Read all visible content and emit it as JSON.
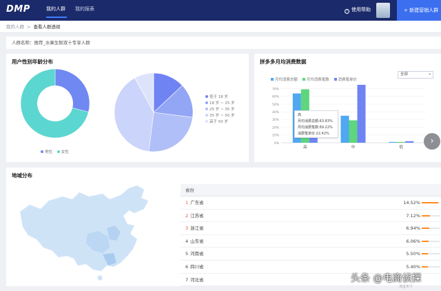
{
  "nav": {
    "logo": "DMP",
    "tabs": [
      {
        "label": "我的人群"
      },
      {
        "label": "我的报表"
      }
    ],
    "help": "使用帮助",
    "new_button": "+ 新建营销人群"
  },
  "breadcrumb": {
    "parent": "我的人群",
    "separator": ">",
    "current": "查看人群透视"
  },
  "crowd_name": "人群名称：推荐_水果生鲜双十专享人群",
  "gender_age": {
    "title": "用户性别年龄分布",
    "gender_legend": [
      "男性",
      "女性"
    ],
    "age_legend": [
      "低于 18 岁",
      "18 岁 ~ 25 岁",
      "25 岁 ~ 35 岁",
      "35 岁 ~ 50 岁",
      "高于 50 岁"
    ],
    "colors": {
      "male": "#6f88f2",
      "female": "#5cd6d0",
      "age": [
        "#6f84f2",
        "#93a5f5",
        "#b1bff8",
        "#cbd4fa",
        "#dde3fb"
      ]
    }
  },
  "consume": {
    "title": "拼多多月均消费数据",
    "legend": [
      "月均消费总额",
      "月均消费笔数",
      "消费笔单价"
    ],
    "select_value": "全部",
    "tooltip": {
      "title": "高",
      "lines": [
        "月均消费总额:63.83%",
        "月均消费笔数:69.22%",
        "消费笔单价:22.42%"
      ]
    },
    "colors": [
      "#4fa8f0",
      "#5dd67e",
      "#6f84f2"
    ]
  },
  "chart_data": [
    {
      "type": "pie",
      "title": "用户性别年龄分布",
      "categories": [
        "男性",
        "女性"
      ],
      "values": [
        29,
        71
      ]
    },
    {
      "type": "pie",
      "categories": [
        "低于 18 岁",
        "18 岁 ~ 25 岁",
        "25 岁 ~ 35 岁",
        "35 岁 ~ 50 岁",
        "高于 50 岁"
      ],
      "values": [
        13,
        14,
        25,
        40,
        8
      ]
    },
    {
      "type": "bar",
      "title": "拼多多月均消费数据",
      "categories": [
        "高",
        "中",
        "低"
      ],
      "series": [
        {
          "name": "月均消费总额",
          "values": [
            63.83,
            35,
            1
          ]
        },
        {
          "name": "月均消费笔数",
          "values": [
            69.22,
            29,
            1
          ]
        },
        {
          "name": "消费笔单价",
          "values": [
            22.42,
            75,
            2
          ]
        }
      ],
      "yticks": [
        "0%",
        "10%",
        "20%",
        "30%",
        "40%",
        "50%",
        "60%",
        "70%"
      ],
      "ylim": [
        0,
        75
      ]
    }
  ],
  "region": {
    "title": "地域分布",
    "column_header": "省份",
    "rows": [
      {
        "rank": "1",
        "name": "广东省",
        "pct": "14.52%",
        "share": 0.1452
      },
      {
        "rank": "2",
        "name": "江苏省",
        "pct": "7.12%",
        "share": 0.0712
      },
      {
        "rank": "3",
        "name": "浙江省",
        "pct": "6.94%",
        "share": 0.0694
      },
      {
        "rank": "4",
        "name": "山东省",
        "pct": "6.06%",
        "share": 0.0606
      },
      {
        "rank": "5",
        "name": "河南省",
        "pct": "5.50%",
        "share": 0.055
      },
      {
        "rank": "6",
        "name": "四川省",
        "pct": "5.40%",
        "share": 0.054
      },
      {
        "rank": "7",
        "name": "河北省",
        "pct": "",
        "share": 0
      }
    ]
  },
  "watermark": "头条 @电商侦探",
  "watermark_sub": "淘宝天下"
}
